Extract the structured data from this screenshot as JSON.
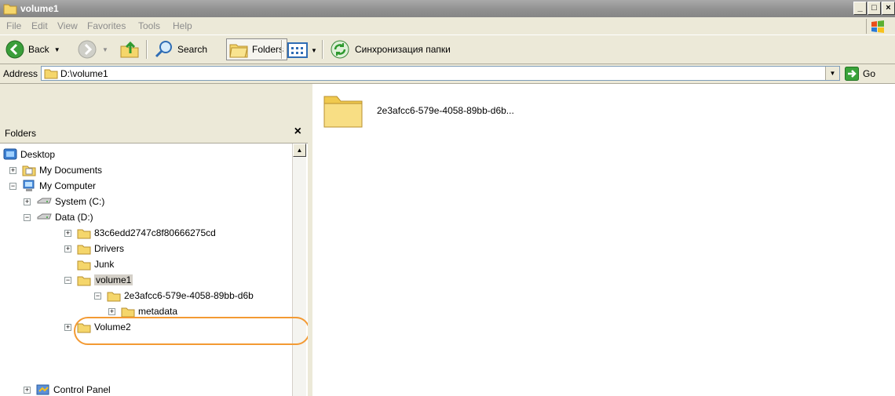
{
  "window": {
    "title": "volume1"
  },
  "menu": [
    "File",
    "Edit",
    "View",
    "Favorites",
    "Tools",
    "Help"
  ],
  "toolbar": {
    "back": "Back",
    "search": "Search",
    "folders": "Folders",
    "sync": "Синхронизация папки"
  },
  "address": {
    "label": "Address",
    "value": "D:\\volume1",
    "go": "Go"
  },
  "folders_pane": {
    "title": "Folders",
    "tree": {
      "desktop": "Desktop",
      "my_documents": "My Documents",
      "my_computer": "My Computer",
      "system_c": "System (C:)",
      "data_d": "Data (D:)",
      "folder_hash": "83c6edd2747c8f80666275cd",
      "drivers": "Drivers",
      "junk": "Junk",
      "volume1": "volume1",
      "guid_folder": "2e3afcc6-579e-4058-89bb-d6b",
      "metadata": "metadata",
      "volume2": "Volume2",
      "control_panel": "Control Panel"
    }
  },
  "content": {
    "items": [
      {
        "label": "2e3afcc6-579e-4058-89bb-d6b..."
      }
    ]
  },
  "colors": {
    "highlight": "#f39a33",
    "folder": "#f5d66b"
  }
}
